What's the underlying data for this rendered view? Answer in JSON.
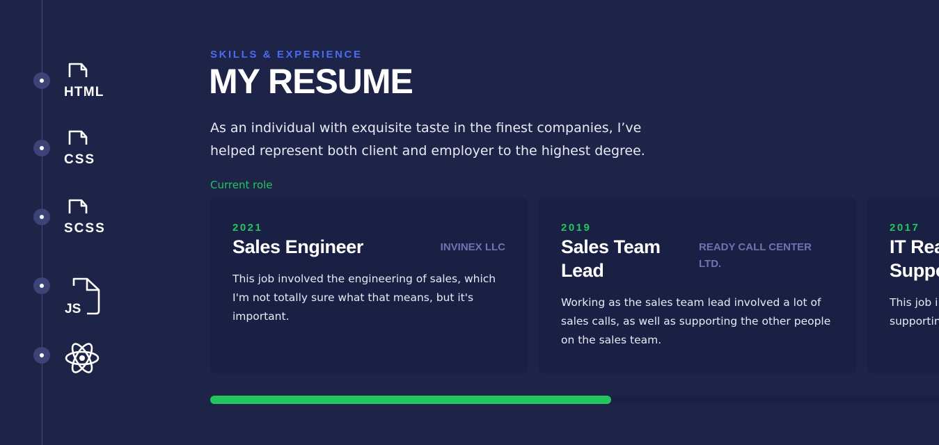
{
  "skills": [
    {
      "name": "html",
      "icon": "html-file-icon",
      "label": "HTML"
    },
    {
      "name": "css",
      "icon": "css-file-icon",
      "label": "CSS"
    },
    {
      "name": "scss",
      "icon": "scss-file-icon",
      "label": "SCSS"
    },
    {
      "name": "js",
      "icon": "js-file-icon",
      "label": "JS"
    },
    {
      "name": "react",
      "icon": "react-atom-icon"
    }
  ],
  "header": {
    "eyebrow": "SKILLS & EXPERIENCE",
    "title": "MY RESUME",
    "intro": "As an individual with exquisite taste in the finest companies, I’ve helped represent both client and employer to the highest degree.",
    "current_label": "Current role"
  },
  "experience": [
    {
      "year": "2021",
      "role": "Sales Engineer",
      "company": "INVINEX LLC",
      "description": "This job involved the engineering of sales, which I'm not totally sure what that means, but it's important."
    },
    {
      "year": "2019",
      "role": "Sales Team Lead",
      "company": "READY CALL CENTER LTD.",
      "description": "Working as the sales team lead involved a lot of sales calls, as well as supporting the other people on the sales team."
    },
    {
      "year": "2017",
      "role": "IT Rea Suppo",
      "company": "",
      "description": "This job i supportin"
    }
  ],
  "carousel": {
    "scroll_progress": 0.55
  },
  "colors": {
    "background": "#1e2447",
    "card": "#1a1f44",
    "accent_green": "#22c55e",
    "accent_blue": "#4d6bf0",
    "company_text": "#6c74b2"
  }
}
